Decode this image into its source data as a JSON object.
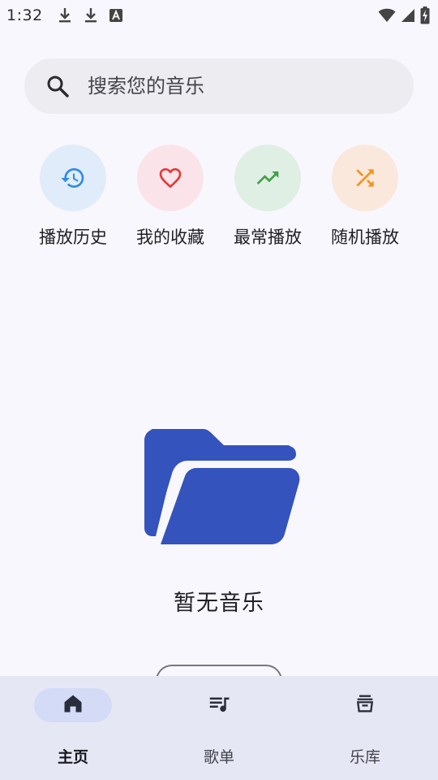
{
  "status_bar": {
    "time": "1:32",
    "left_icons": [
      "download-icon",
      "download-icon",
      "text-a-icon"
    ],
    "right_icons": [
      "wifi-icon",
      "signal-icon",
      "battery-charging-icon"
    ]
  },
  "search": {
    "placeholder": "搜索您的音乐",
    "value": ""
  },
  "quick_actions": [
    {
      "label": "播放历史",
      "icon": "history-icon",
      "bg": "#e0ecfa",
      "color": "#2f8be8"
    },
    {
      "label": "我的收藏",
      "icon": "heart-icon",
      "bg": "#fae4ea",
      "color": "#e53935"
    },
    {
      "label": "最常播放",
      "icon": "trending-up-icon",
      "bg": "#e0efe4",
      "color": "#43a047"
    },
    {
      "label": "随机播放",
      "icon": "shuffle-icon",
      "bg": "#fbe8dc",
      "color": "#f5921e"
    }
  ],
  "empty": {
    "icon": "folder-open-icon",
    "icon_color": "#3453bd",
    "text": "暂无音乐"
  },
  "bottom_nav": {
    "items": [
      {
        "label": "主页",
        "icon": "home-icon",
        "active": true
      },
      {
        "label": "歌单",
        "icon": "playlist-icon",
        "active": false
      },
      {
        "label": "乐库",
        "icon": "library-icon",
        "active": false
      }
    ]
  }
}
